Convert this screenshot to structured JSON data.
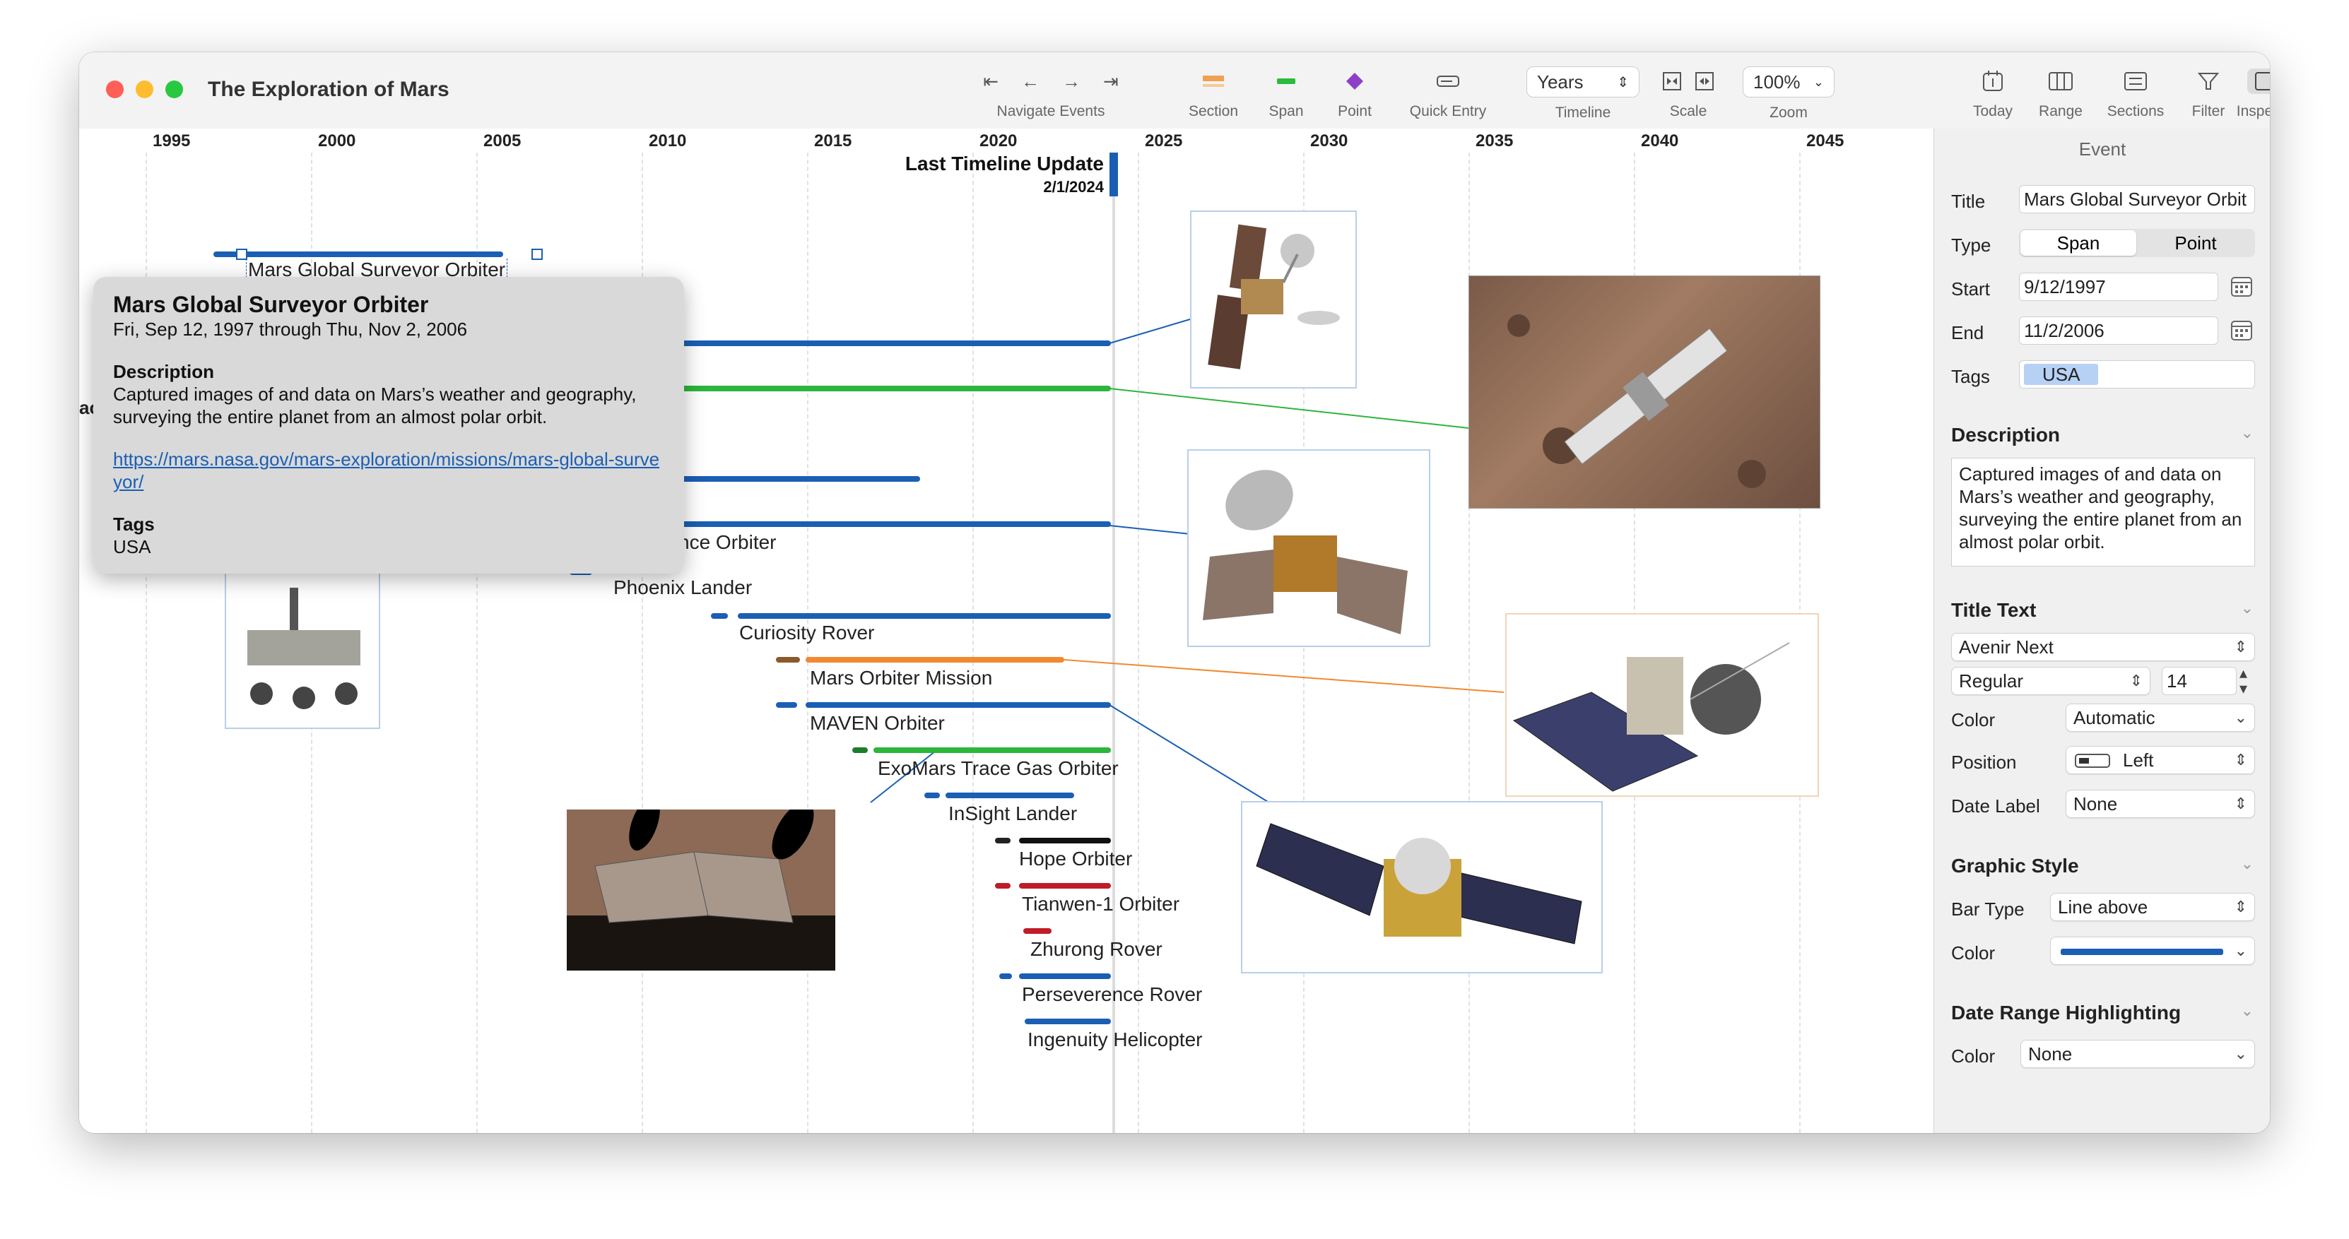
{
  "window": {
    "title": "The Exploration of Mars"
  },
  "toolbar": {
    "navigate_label": "Navigate Events",
    "section_label": "Section",
    "span_label": "Span",
    "point_label": "Point",
    "quick_entry_label": "Quick Entry",
    "timeline_label": "Timeline",
    "timeline_value": "Years",
    "scale_label": "Scale",
    "zoom_label": "Zoom",
    "zoom_value": "100%",
    "today_label": "Today",
    "range_label": "Range",
    "sections_label": "Sections",
    "filter_label": "Filter",
    "inspector_label": "Inspector",
    "colors": {
      "section": "#f0a050",
      "span": "#2dbb3c",
      "point": "#8e3fc8"
    }
  },
  "ruler": {
    "years": [
      "1995",
      "2000",
      "2005",
      "2010",
      "2015",
      "2020",
      "2025",
      "2030",
      "2035",
      "2040",
      "2045"
    ]
  },
  "timeline": {
    "last_update_title": "Last Timeline Update",
    "last_update_date": "2/1/2024",
    "partial_label": "ac",
    "events": [
      {
        "name": "Mars Global Surveyor Orbiter",
        "color": "#1a5fb4"
      },
      {
        "name": "Mars Reconnaissance Orbiter",
        "color": "#1a5fb4",
        "label_visible": "nce Orbiter"
      },
      {
        "name": "Phoenix Lander",
        "color": "#1a5fb4"
      },
      {
        "name": "Curiosity Rover",
        "color": "#1a5fb4"
      },
      {
        "name": "Mars Orbiter Mission",
        "color": "#f08a30"
      },
      {
        "name": "MAVEN Orbiter",
        "color": "#1a5fb4"
      },
      {
        "name": "ExoMars Trace Gas Orbiter",
        "color": "#2db53c"
      },
      {
        "name": "InSight Lander",
        "color": "#1a5fb4"
      },
      {
        "name": "Hope Orbiter",
        "color": "#111111"
      },
      {
        "name": "Tianwen-1 Orbiter",
        "color": "#c01c28"
      },
      {
        "name": "Zhurong Rover",
        "color": "#c01c28"
      },
      {
        "name": "Perseverence Rover",
        "color": "#1a5fb4"
      },
      {
        "name": "Ingenuity Helicopter",
        "color": "#1a5fb4"
      }
    ]
  },
  "popover": {
    "title": "Mars Global Surveyor Orbiter",
    "dates": "Fri, Sep 12, 1997 through Thu, Nov 2, 2006",
    "description_heading": "Description",
    "description": "Captured images of and data on Mars’s weather and geography, surveying the entire planet from an almost polar orbit.",
    "link": "https://mars.nasa.gov/mars-exploration/missions/mars-global-surveyor/",
    "tags_heading": "Tags",
    "tags": "USA"
  },
  "inspector": {
    "header": "Event",
    "title_label": "Title",
    "title_value": "Mars Global Surveyor Orbit",
    "type_label": "Type",
    "type_span": "Span",
    "type_point": "Point",
    "start_label": "Start",
    "start_value": "9/12/1997",
    "end_label": "End",
    "end_value": "11/2/2006",
    "tags_label": "Tags",
    "tag_value": "USA",
    "description_heading": "Description",
    "description_text": "Captured images of and data on Mars’s weather and geography, surveying the entire planet from an almost polar orbit.",
    "title_text_heading": "Title Text",
    "font_value": "Avenir Next",
    "weight_value": "Regular",
    "size_value": "14",
    "color_label": "Color",
    "color_value": "Automatic",
    "position_label": "Position",
    "position_value": "Left",
    "date_label_label": "Date Label",
    "date_label_value": "None",
    "graphic_style_heading": "Graphic Style",
    "bar_type_label": "Bar Type",
    "bar_type_value": "Line above",
    "graphic_color_label": "Color",
    "graphic_color_swatch": "#1a5fb4",
    "date_range_heading": "Date Range Highlighting",
    "range_color_label": "Color",
    "range_color_value": "None"
  }
}
